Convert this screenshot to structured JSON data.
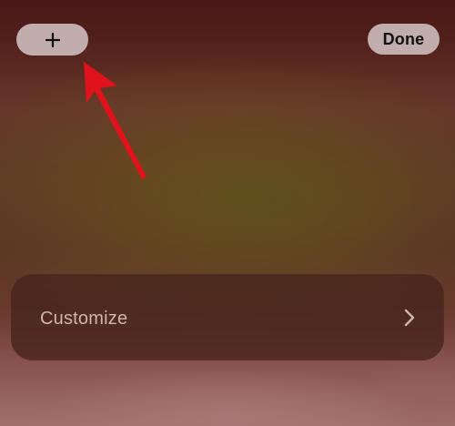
{
  "toolbar": {
    "add_icon": "plus-icon",
    "done_label": "Done"
  },
  "customize": {
    "label": "Customize",
    "chevron_icon": "chevron-right-icon"
  },
  "annotation": {
    "arrow_icon": "red-arrow-icon",
    "color": "#e0121c"
  },
  "colors": {
    "pill_bg": "#cdbebc",
    "card_bg": "#46241c",
    "card_text": "#cdb6ae"
  }
}
